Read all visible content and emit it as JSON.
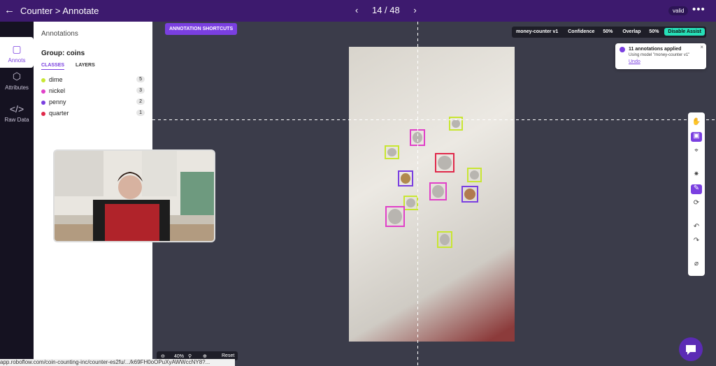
{
  "topbar": {
    "breadcrumb": "Counter > Annotate",
    "pager": "14 / 48",
    "status_badge": "valid"
  },
  "rail": [
    {
      "label": "Annots",
      "icon": "annotation-icon",
      "active": true
    },
    {
      "label": "Attributes",
      "icon": "tag-icon"
    },
    {
      "label": "Raw Data",
      "icon": "code-icon"
    }
  ],
  "panel": {
    "heading": "Annotations",
    "group": "Group: coins",
    "tabs": [
      "CLASSES",
      "LAYERS"
    ],
    "classes": [
      {
        "name": "dime",
        "count": "5",
        "color": "#c8e632"
      },
      {
        "name": "nickel",
        "count": "3",
        "color": "#e040c8"
      },
      {
        "name": "penny",
        "count": "2",
        "color": "#7a3fe0"
      },
      {
        "name": "quarter",
        "count": "1",
        "color": "#e0284a"
      }
    ]
  },
  "canvas": {
    "shortcuts_button": "ANNOTATION SHORTCUTS",
    "model": "money-counter v1",
    "confidence_label": "Confidence",
    "confidence_value": "50%",
    "overlap_label": "Overlap",
    "overlap_value": "50%",
    "assist_button": "Disable Assist"
  },
  "toast": {
    "title": "11 annotations applied",
    "body": "Using model \"money-counter v1\"",
    "link": "Undo"
  },
  "zoom": {
    "value": "40%",
    "reset": "Reset"
  },
  "statusbar": {
    "url": "app.roboflow.com/coin-counting-inc/counter-es2fu/.../k69FH0oOPuXyAWWccNY8?..."
  }
}
